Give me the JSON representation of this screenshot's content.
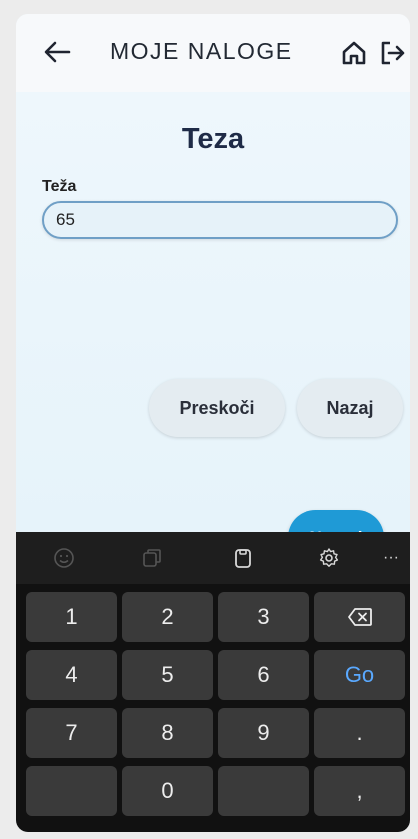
{
  "header": {
    "title": "MOJE NALOGE"
  },
  "page": {
    "heading": "Teza",
    "field_label": "Teža",
    "field_value": "65"
  },
  "buttons": {
    "skip": "Preskoči",
    "back": "Nazaj",
    "next": "Naprej"
  },
  "keyboard": {
    "toolbar_icons": [
      "emoji-icon",
      "clipboard-icon",
      "paste-icon",
      "settings-icon",
      "more-icon"
    ],
    "toolbar_more": "···",
    "keys": {
      "k1": "1",
      "k2": "2",
      "k3": "3",
      "k4": "4",
      "k5": "5",
      "k6": "6",
      "k7": "7",
      "k8": "8",
      "k9": "9",
      "k0": "0",
      "go": "Go",
      "dot": ".",
      "comma": ","
    }
  },
  "colors": {
    "accent": "#1f9ad6",
    "keyboard_bg": "#111111",
    "key_bg": "#3a3a3a",
    "go_text": "#5aa9ff"
  }
}
